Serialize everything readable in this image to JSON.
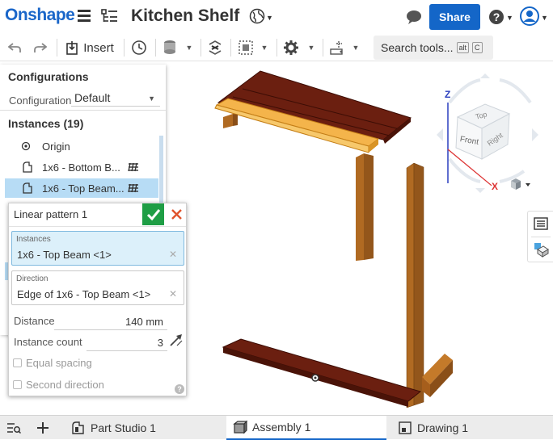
{
  "app": {
    "logo": "Onshape",
    "document_title": "Kitchen Shelf",
    "share_label": "Share"
  },
  "toolbar": {
    "insert_label": "Insert",
    "search_placeholder": "Search tools...",
    "search_shortcut_1": "alt",
    "search_shortcut_2": "C"
  },
  "left_panel": {
    "configurations_title": "Configurations",
    "configuration_label": "Configuration",
    "configuration_value": "Default",
    "instances_title": "Instances (19)",
    "items": [
      {
        "label": "Origin"
      },
      {
        "label": "1x6 - Bottom B..."
      },
      {
        "label": "1x6 - Top Beam..."
      }
    ]
  },
  "dialog": {
    "title": "Linear pattern 1",
    "instances_label": "Instances",
    "instances_value": "1x6 - Top Beam <1>",
    "direction_label": "Direction",
    "direction_value": "Edge of 1x6 - Top Beam <1>",
    "distance_label": "Distance",
    "distance_value": "140 mm",
    "instance_count_label": "Instance count",
    "instance_count_value": "3",
    "equal_spacing_label": "Equal spacing",
    "second_direction_label": "Second direction",
    "help_glyph": "?"
  },
  "viewcube": {
    "top": "Top",
    "front": "Front",
    "right": "Right",
    "axis_x": "X",
    "axis_z": "Z"
  },
  "tabs": [
    {
      "label": "Part Studio 1"
    },
    {
      "label": "Assembly 1"
    },
    {
      "label": "Drawing 1"
    }
  ],
  "colors": {
    "brand_blue": "#1466c8",
    "confirm_green": "#1e9e45",
    "cancel_red": "#e0522b",
    "selected_row": "#b7dcf5",
    "wood_dark": "#6b1f10",
    "wood_highlight": "#f4b44b",
    "wood_post": "#b06a22"
  }
}
